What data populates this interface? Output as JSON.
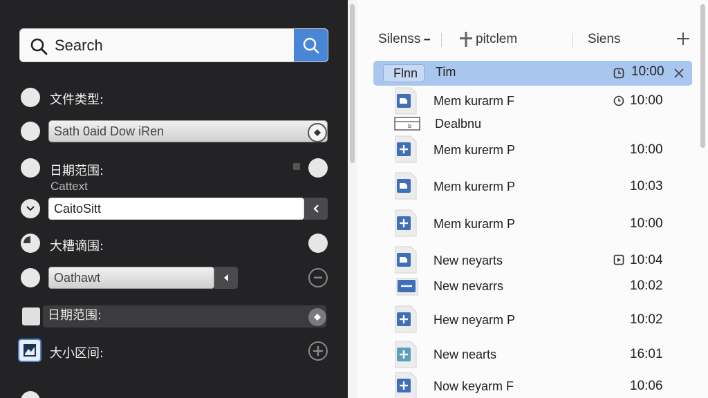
{
  "left_panel": {
    "search": {
      "placeholder": "Search"
    },
    "filters": [
      {
        "label": "文件类型:"
      },
      {
        "field_value": "Sath 0aid Dow iRen"
      },
      {
        "label": "日期范围:",
        "sub": "Cattext"
      },
      {
        "field_value": "CaitoSitt"
      },
      {
        "label": "大糟谪围:"
      },
      {
        "field_value": "Oathawt"
      },
      {
        "label": "日期范围:"
      },
      {
        "label": "大小区间:"
      }
    ]
  },
  "right_panel": {
    "headers": [
      "Silenss",
      "pitclem",
      "Siens"
    ],
    "selected_row": {
      "tag": "Flnn",
      "name": "Tim",
      "time": "10:00"
    },
    "rows": [
      {
        "name": "Mem kurarm F",
        "time": "10:00",
        "icon": "doc-icon",
        "has_clock": true
      },
      {
        "name": "Dealbnu",
        "time": "",
        "icon": "row-icon",
        "has_clock": false
      },
      {
        "name": "Mem kurerm P",
        "time": "10:00",
        "icon": "plus-doc-icon",
        "has_clock": false
      },
      {
        "name": "Mem kurerm P",
        "time": "10:03",
        "icon": "doc-icon",
        "has_clock": false
      },
      {
        "name": "Mem kurarm P",
        "time": "10:00",
        "icon": "plus-doc-icon",
        "has_clock": false
      },
      {
        "name": "New neyarts",
        "time": "10:04",
        "icon": "doc-icon",
        "has_clock": true
      },
      {
        "name": "New nevarrs",
        "time": "10:02",
        "icon": "minus-doc-icon",
        "has_clock": false
      },
      {
        "name": "Hew neyarm P",
        "time": "10:02",
        "icon": "plus-doc-icon",
        "has_clock": false
      },
      {
        "name": "New nearts",
        "time": "16:01",
        "icon": "teal-doc-icon",
        "has_clock": false
      },
      {
        "name": "Now keyarm F",
        "time": "10:06",
        "icon": "plus-doc-icon",
        "has_clock": false
      }
    ]
  },
  "colors": {
    "accent": "#4a86d6",
    "selected": "#a9c6ee",
    "dark_bg": "#232325"
  }
}
